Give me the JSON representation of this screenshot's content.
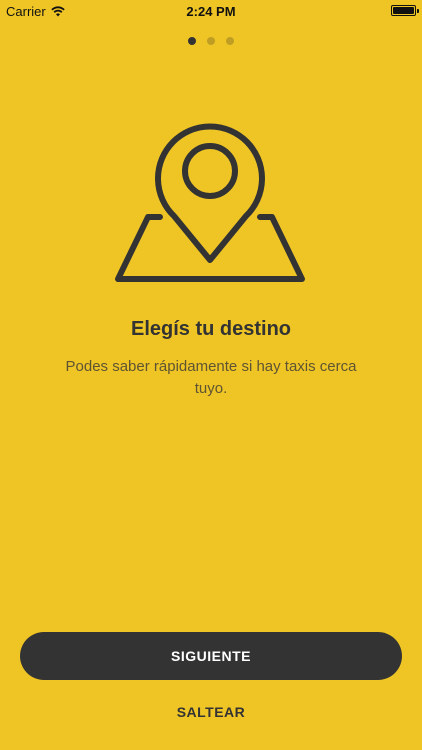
{
  "status_bar": {
    "carrier": "Carrier",
    "time": "2:24 PM",
    "wifi_icon": "wifi-icon",
    "battery_icon": "battery-icon"
  },
  "pager": {
    "total": 3,
    "active_index": 0
  },
  "onboarding": {
    "illustration_icon": "map-pin-icon",
    "title": "Elegís tu destino",
    "description": "Podes saber rápidamente si hay taxis cerca tuyo."
  },
  "actions": {
    "next_label": "SIGUIENTE",
    "skip_label": "SALTEAR"
  },
  "colors": {
    "background": "#EFC526",
    "primary_dark": "#333333",
    "button_text": "#FFFFFF"
  }
}
